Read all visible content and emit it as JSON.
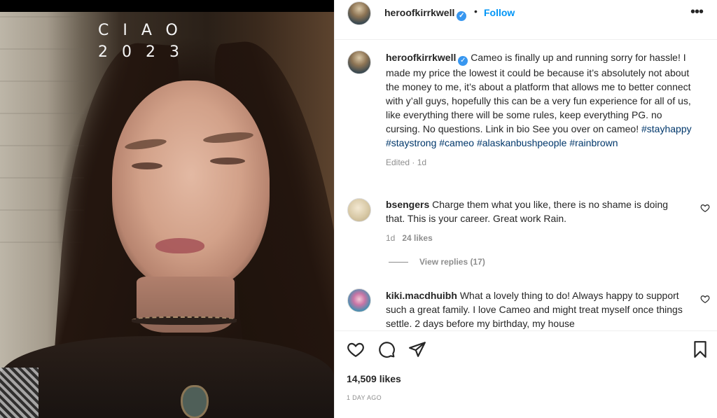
{
  "photo": {
    "caption_line1": "CIAO",
    "caption_line2": "2023"
  },
  "post": {
    "username": "heroofkirrkwell",
    "verified": true,
    "follow_label": "Follow",
    "separator": "•",
    "more_label": "•••",
    "caption": {
      "username": "heroofkirrkwell",
      "text": "Cameo is finally up and running sorry for hassle! I made my price the lowest it could be because it’s absolutely not about the money to me, it’s about a platform that allows me to better connect with y’all guys, hopefully this can be a very fun experience for all of us, like everything there will be some rules, keep everything PG. no cursing. No questions. Link in bio See you over on cameo!",
      "hashtags": [
        "#stayhappy",
        "#staystrong",
        "#cameo",
        "#alaskanbushpeople",
        "#rainbrown"
      ],
      "meta": "Edited · 1d"
    },
    "comments": [
      {
        "username": "bsengers",
        "text": "Charge them what you like, there is no shame is doing that. This is your career. Great work Rain.",
        "time": "1d",
        "likes": "24 likes",
        "view_replies": "View replies (17)"
      },
      {
        "username": "kiki.macdhuibh",
        "text": "What a lovely thing to do! Always happy to support such a great family. I love Cameo and might treat myself once things settle. 2 days before my birthday, my house"
      }
    ],
    "likes_count": "14,509 likes",
    "time_ago": "1 DAY AGO"
  },
  "icons": {
    "heart": "heart-icon",
    "comment": "comment-icon",
    "share": "share-icon",
    "bookmark": "bookmark-icon",
    "verified": "verified-badge-icon",
    "more": "more-options-icon"
  },
  "colors": {
    "follow": "#0095f6",
    "verified": "#3897f0",
    "hashtag": "#00376b",
    "muted": "#8e8e8e"
  }
}
